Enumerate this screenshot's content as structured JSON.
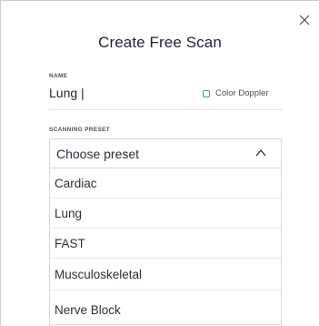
{
  "dialog": {
    "title": "Create Free Scan",
    "name_label": "NAME",
    "name_value": "Lung |",
    "color_doppler_label": "Color Doppler",
    "scanning_preset_label": "SCANNING PRESET",
    "preset_placeholder": "Choose preset",
    "preset_options": [
      "Cardiac",
      "Lung",
      "FAST",
      "Musculoskeletal",
      "Nerve Block"
    ]
  },
  "icons": {
    "close": "close-icon",
    "chevron": "chevron-up-icon",
    "checkbox": "checkbox-unchecked"
  },
  "colors": {
    "accent_green": "#3aa37a",
    "text_dark": "#1f2433",
    "border": "#d6dadf"
  }
}
